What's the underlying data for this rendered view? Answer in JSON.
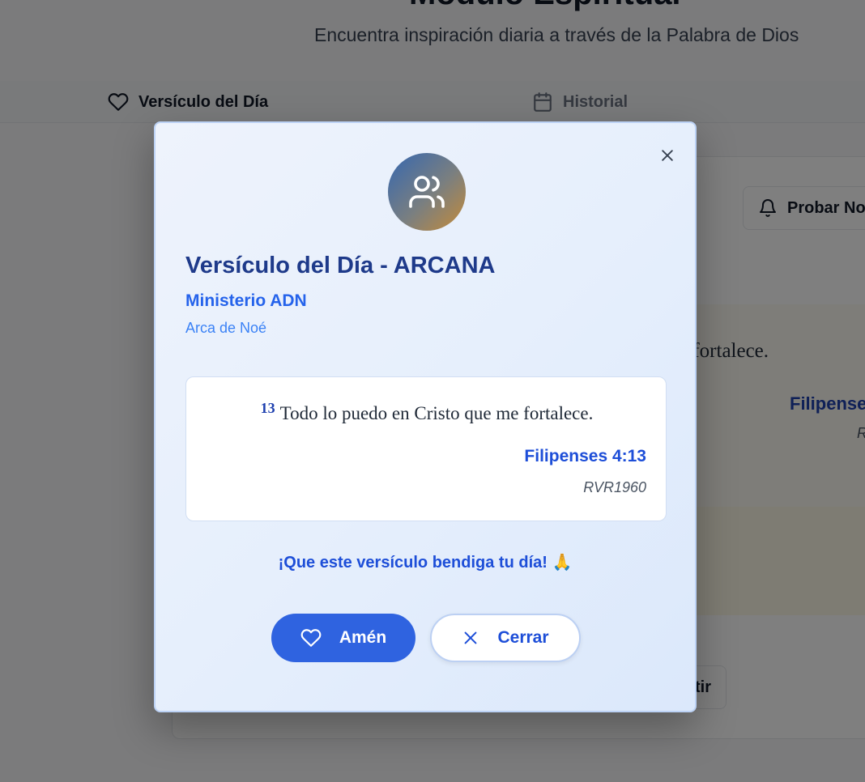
{
  "background": {
    "header": {
      "title": "Módulo Espiritual",
      "subtitle": "Encuentra inspiración diaria a través de la Palabra de Dios"
    },
    "tabs": [
      {
        "label": "Versículo del Día",
        "icon": "heart-icon"
      },
      {
        "label": "Historial",
        "icon": "calendar-icon"
      }
    ],
    "test_notification_label": "Probar No",
    "verse_fragment": "e fortalece.",
    "reference_fragment": "Filipense",
    "version_fragment": "R",
    "share_fragment": "tir"
  },
  "modal": {
    "title": "Versículo del Día - ARCANA",
    "ministry": "Ministerio ADN",
    "place": "Arca de Noé",
    "avatar_icon": "users-icon",
    "verse": {
      "number": "13",
      "text": "Todo lo puedo en Cristo que me fortalece.",
      "reference": "Filipenses 4:13",
      "version": "RVR1960"
    },
    "blessing": "¡Que este versículo bendiga tu día! 🙏",
    "buttons": {
      "amen": "Amén",
      "close": "Cerrar"
    }
  },
  "colors": {
    "accent": "#2f63e0",
    "title": "#1e3a8a",
    "link_blue": "#1d4ed8"
  }
}
